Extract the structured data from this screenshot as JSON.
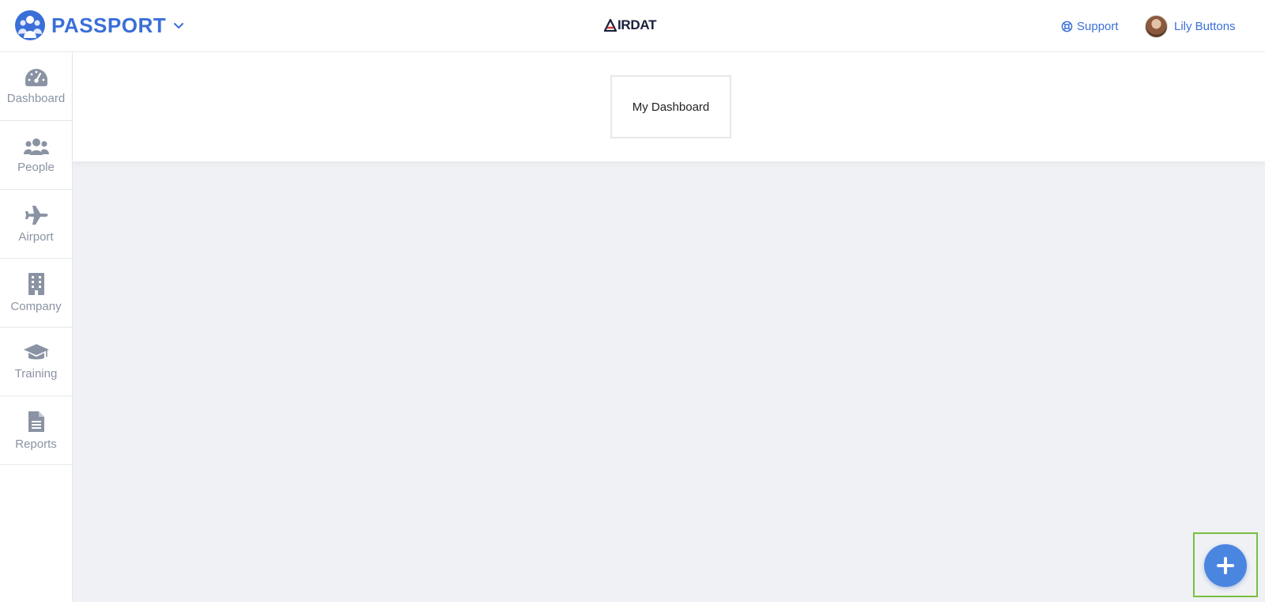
{
  "app": {
    "name": "PASSPORT",
    "center_logo_text": "IRDAT",
    "accent_color": "#3a6fd8"
  },
  "header": {
    "support_label": "Support",
    "user_name": "Lily Buttons"
  },
  "sidebar": {
    "items": [
      {
        "label": "Dashboard",
        "icon": "gauge-icon"
      },
      {
        "label": "People",
        "icon": "users-icon"
      },
      {
        "label": "Airport",
        "icon": "plane-icon"
      },
      {
        "label": "Company",
        "icon": "building-icon"
      },
      {
        "label": "Training",
        "icon": "graduation-cap-icon"
      },
      {
        "label": "Reports",
        "icon": "document-icon"
      }
    ]
  },
  "main": {
    "dashboard_tab_label": "My Dashboard",
    "fab_icon": "plus-icon",
    "fab_color": "#4a86e0"
  }
}
